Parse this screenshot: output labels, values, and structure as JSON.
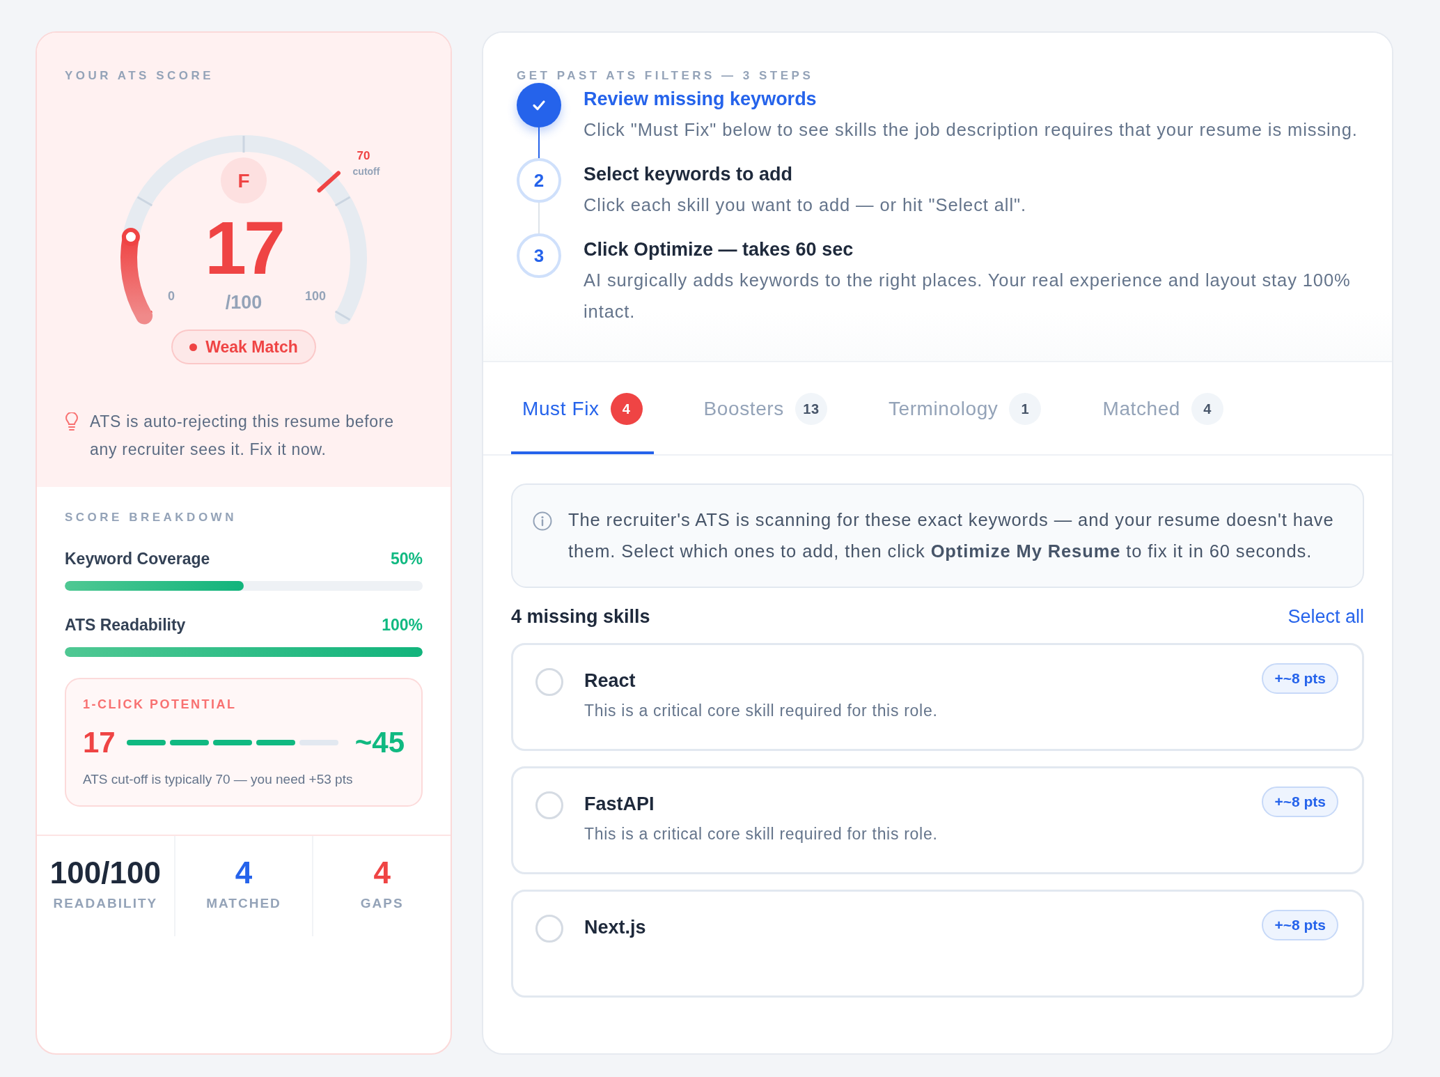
{
  "score_card": {
    "title": "YOUR ATS SCORE",
    "gauge": {
      "level": 0.17,
      "grade": "F",
      "score": "17",
      "out_of": "/100",
      "min_label": "0",
      "max_label": "100",
      "cutoff_value": "70",
      "cutoff_caption": "cutoff"
    },
    "verdict": "Weak Match",
    "tip": "ATS is auto-rejecting this resume before any recruiter sees it. Fix it now.",
    "breakdown_title": "SCORE BREAKDOWN",
    "metrics": [
      {
        "label": "Keyword Coverage",
        "reading": "50%",
        "level": 0.5
      },
      {
        "label": "ATS Readability",
        "reading": "100%",
        "level": 1
      }
    ],
    "potential": {
      "title": "1-CLICK POTENTIAL",
      "from": "17",
      "to": "~45",
      "segments": [
        {
          "filled": true
        },
        {
          "filled": true
        },
        {
          "filled": true
        },
        {
          "filled": true
        },
        {
          "filled": false
        }
      ],
      "note": "ATS cut-off is typically 70 — you need +53 pts"
    },
    "stats": [
      {
        "value": "100/100",
        "label": "READABILITY",
        "color": "#1e293b"
      },
      {
        "value": "4",
        "label": "MATCHED",
        "color": "#2563eb"
      },
      {
        "value": "4",
        "label": "GAPS",
        "color": "#ef4444"
      }
    ]
  },
  "steps_panel": {
    "title": "GET PAST ATS FILTERS — 3 STEPS",
    "steps": [
      {
        "completed": true,
        "title": "Review missing keywords",
        "text": "Click \"Must Fix\" below to see skills the job description requires that your resume is missing."
      },
      {
        "number": "2",
        "completed": false,
        "title": "Select keywords to add",
        "text": "Click each skill you want to add — or hit \"Select all\"."
      },
      {
        "number": "3",
        "completed": false,
        "title": "Click Optimize — takes 60 sec",
        "text": "AI surgically adds keywords to the right places. Your real experience and layout stay 100% intact."
      }
    ]
  },
  "tabs": [
    {
      "label": "Must Fix",
      "count": "4",
      "selected": true
    },
    {
      "label": "Boosters",
      "count": "13",
      "selected": false
    },
    {
      "label": "Terminology",
      "count": "1",
      "selected": false
    },
    {
      "label": "Matched",
      "count": "4",
      "selected": false
    }
  ],
  "notice": "The recruiter's ATS is scanning for these exact keywords — and your resume doesn't have them. Select which ones to add, then click **Optimize My Resume** to fix it in 60 seconds.",
  "skills_header": {
    "count_label": "4 missing skills",
    "select_all": "Select all"
  },
  "skills": [
    {
      "name": "React",
      "description": "This is a critical core skill required for this role.",
      "points": "+~8 pts",
      "selected": false
    },
    {
      "name": "FastAPI",
      "description": "This is a critical core skill required for this role.",
      "points": "+~8 pts",
      "selected": false
    },
    {
      "name": "Next.js",
      "points": "+~8 pts",
      "selected": false
    }
  ]
}
